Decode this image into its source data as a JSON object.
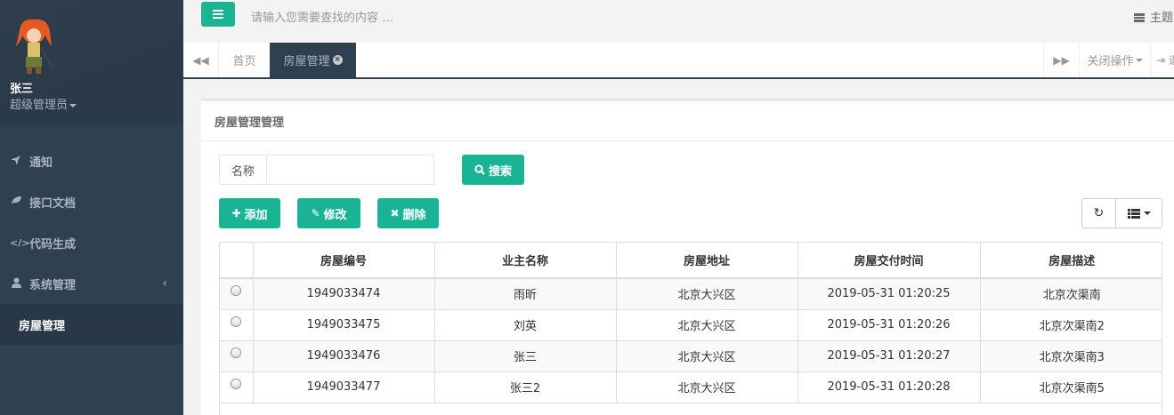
{
  "profile": {
    "name": "张三",
    "role": "超级管理员"
  },
  "sidebar": {
    "items": [
      {
        "label": "通知",
        "icon": "rocket-icon"
      },
      {
        "label": "接口文档",
        "icon": "leaf-icon"
      },
      {
        "label": "代码生成",
        "icon": "code-icon"
      },
      {
        "label": "系统管理",
        "icon": "user-icon"
      }
    ],
    "active_sub": "房屋管理"
  },
  "topbar": {
    "search_placeholder": "请输入您需要查找的内容 …",
    "theme_label": "主题"
  },
  "tabs": {
    "home": "首页",
    "active": "房屋管理",
    "close_ops": "关闭操作",
    "exit": "退出"
  },
  "panel": {
    "title": "房屋管理管理",
    "search_label": "名称",
    "search_value": "",
    "search_button": "搜索",
    "add_button": "添加",
    "edit_button": "修改",
    "delete_button": "删除"
  },
  "table": {
    "columns": [
      "房屋编号",
      "业主名称",
      "房屋地址",
      "房屋交付时间",
      "房屋描述"
    ],
    "rows": [
      [
        "1949033474",
        "雨昕",
        "北京大兴区",
        "2019-05-31 01:20:25",
        "北京次渠南"
      ],
      [
        "1949033475",
        "刘英",
        "北京大兴区",
        "2019-05-31 01:20:26",
        "北京次渠南2"
      ],
      [
        "1949033476",
        "张三",
        "北京大兴区",
        "2019-05-31 01:20:27",
        "北京次渠南3"
      ],
      [
        "1949033477",
        "张三2",
        "北京大兴区",
        "2019-05-31 01:20:28",
        "北京次渠南5"
      ]
    ]
  },
  "colors": {
    "sidebar_bg": "#2f4050",
    "accent": "#1ab394",
    "sidebar_text": "#a7b1c2"
  }
}
